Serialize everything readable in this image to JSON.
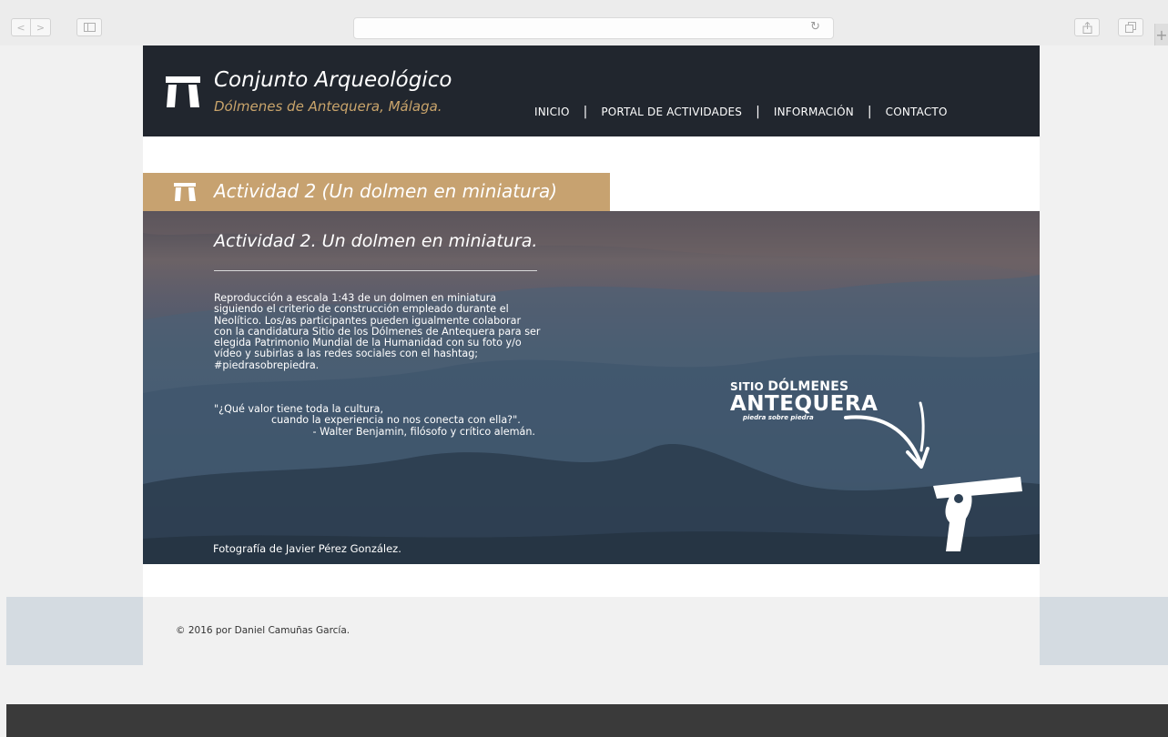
{
  "browser": {
    "back_icon": "<",
    "forward_icon": ">",
    "sidebar_icon": "sidebar-icon",
    "reload_icon": "↻",
    "share_icon": "share-icon",
    "tabs_icon": "tabs-icon",
    "newtab_icon": "+"
  },
  "header": {
    "title": "Conjunto Arqueológico",
    "subtitle": "Dólmenes de Antequera, Málaga.",
    "nav": [
      {
        "label": "INICIO"
      },
      {
        "label": "PORTAL DE ACTIVIDADES"
      },
      {
        "label": "INFORMACIÓN"
      },
      {
        "label": "CONTACTO"
      }
    ],
    "separator": "|"
  },
  "banner": {
    "title": "Actividad 2 (Un dolmen en miniatura)"
  },
  "hero": {
    "title": "Actividad 2. Un dolmen en miniatura.",
    "body": "Reproducción a escala 1:43 de un dolmen en miniatura siguiendo el criterio de construcción empleado durante el Neolítico. Los/as participantes pueden igualmente colaborar con la candidatura Sitio de los Dólmenes de Antequera para ser elegida Patrimonio Mundial de la Humanidad con su foto y/o vídeo y subirlas a las redes sociales con el hashtag; #piedrasobrepiedra.",
    "quote_line1": "\"¿Qué valor tiene toda la cultura,",
    "quote_line2": "cuando la experiencia no nos conecta con ella?\".",
    "quote_line3": "- Walter Benjamin, filósofo y crítico alemán.",
    "photo_credit": "Fotografía de Javier Pérez González.",
    "brand_sitio": "SITIO",
    "brand_dolmenes": "DÓLMENES",
    "brand_antequera": "ANTEQUERA",
    "brand_tagline": "piedra sobre piedra"
  },
  "footer": {
    "copyright": "© 2016 por Daniel Camuñas García."
  },
  "colors": {
    "header_bg": "#21262e",
    "accent_gold": "#c7a270",
    "subtitle_gold": "#c9a46b",
    "page_bg": "#f1f1f1",
    "footer_band": "#d4dbe1",
    "bottom_bar": "#3a3a3a"
  }
}
